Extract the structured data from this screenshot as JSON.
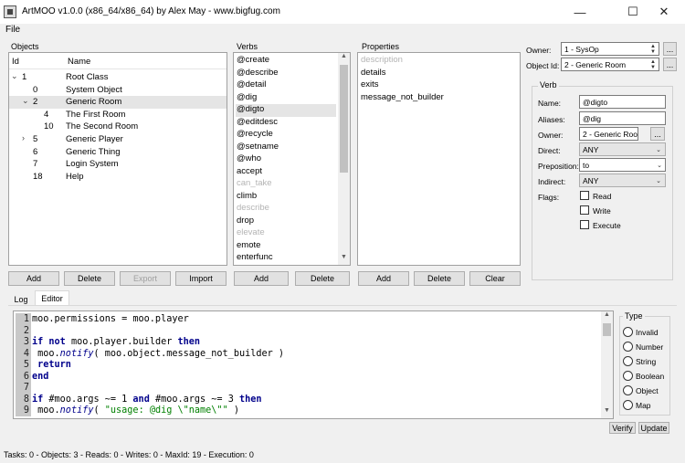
{
  "window": {
    "title": "ArtMOO v1.0.0 (x86_64/x86_64) by Alex May - www.bigfug.com",
    "minimize": "—",
    "maximize": "☐",
    "close": "✕"
  },
  "menu": {
    "file": "File"
  },
  "objects": {
    "label": "Objects",
    "col_id": "Id",
    "col_name": "Name",
    "rows": [
      {
        "id": "1",
        "name": "Root Class",
        "level": 0,
        "arrow": "⌄"
      },
      {
        "id": "0",
        "name": "System Object",
        "level": 1,
        "arrow": ""
      },
      {
        "id": "2",
        "name": "Generic Room",
        "level": 1,
        "arrow": "⌄",
        "selected": true
      },
      {
        "id": "4",
        "name": "The First Room",
        "level": 2,
        "arrow": ""
      },
      {
        "id": "10",
        "name": "The Second Room",
        "level": 2,
        "arrow": ""
      },
      {
        "id": "5",
        "name": "Generic Player",
        "level": 1,
        "arrow": "›"
      },
      {
        "id": "6",
        "name": "Generic Thing",
        "level": 1,
        "arrow": ""
      },
      {
        "id": "7",
        "name": "Login System",
        "level": 1,
        "arrow": ""
      },
      {
        "id": "18",
        "name": "Help",
        "level": 1,
        "arrow": ""
      }
    ],
    "buttons": {
      "add": "Add",
      "delete": "Delete",
      "export": "Export",
      "import": "Import"
    }
  },
  "verbs": {
    "label": "Verbs",
    "items": [
      {
        "text": "@create"
      },
      {
        "text": "@describe"
      },
      {
        "text": "@detail"
      },
      {
        "text": "@dig"
      },
      {
        "text": "@digto",
        "selected": true
      },
      {
        "text": "@editdesc"
      },
      {
        "text": "@recycle"
      },
      {
        "text": "@setname"
      },
      {
        "text": "@who"
      },
      {
        "text": "accept"
      },
      {
        "text": "can_take",
        "dim": true
      },
      {
        "text": "climb"
      },
      {
        "text": "describe",
        "dim": true
      },
      {
        "text": "drop"
      },
      {
        "text": "elevate",
        "dim": true
      },
      {
        "text": "emote"
      },
      {
        "text": "enterfunc"
      }
    ],
    "buttons": {
      "add": "Add",
      "delete": "Delete"
    }
  },
  "properties": {
    "label": "Properties",
    "items": [
      {
        "text": "description",
        "dim": true
      },
      {
        "text": "details"
      },
      {
        "text": "exits"
      },
      {
        "text": "message_not_builder"
      }
    ],
    "buttons": {
      "add": "Add",
      "delete": "Delete",
      "clear": "Clear"
    }
  },
  "top_right": {
    "owner_label": "Owner:",
    "owner_value": "1 - SysOp",
    "object_id_label": "Object Id:",
    "object_id_value": "2 - Generic Room",
    "browse": "..."
  },
  "verb_panel": {
    "title": "Verb",
    "name_label": "Name:",
    "name_value": "@digto",
    "aliases_label": "Aliases:",
    "aliases_value": "@dig",
    "owner_label": "Owner:",
    "owner_value": "2 - Generic Room",
    "browse": "...",
    "direct_label": "Direct:",
    "direct_value": "ANY",
    "preposition_label": "Preposition:",
    "preposition_value": "to",
    "indirect_label": "Indirect:",
    "indirect_value": "ANY",
    "flags_label": "Flags:",
    "flag_read": "Read",
    "flag_write": "Write",
    "flag_execute": "Execute"
  },
  "tabs": {
    "log": "Log",
    "editor": "Editor"
  },
  "editor": {
    "lines": [
      {
        "n": "1",
        "parts": [
          {
            "t": "moo.permissions = moo.player",
            "c": ""
          }
        ]
      },
      {
        "n": "2",
        "parts": []
      },
      {
        "n": "3",
        "parts": [
          {
            "t": "if not",
            "c": "kw"
          },
          {
            "t": " moo.player.builder ",
            "c": ""
          },
          {
            "t": "then",
            "c": "kw"
          }
        ]
      },
      {
        "n": "4",
        "parts": [
          {
            "t": " moo.",
            "c": ""
          },
          {
            "t": "notify",
            "c": "fn"
          },
          {
            "t": "( moo.object.message_not_builder )",
            "c": ""
          }
        ]
      },
      {
        "n": "5",
        "parts": [
          {
            "t": " return",
            "c": "kw"
          }
        ]
      },
      {
        "n": "6",
        "parts": [
          {
            "t": "end",
            "c": "kw"
          }
        ]
      },
      {
        "n": "7",
        "parts": []
      },
      {
        "n": "8",
        "parts": [
          {
            "t": "if",
            "c": "kw"
          },
          {
            "t": " #moo.args ~= 1 ",
            "c": ""
          },
          {
            "t": "and",
            "c": "kw"
          },
          {
            "t": " #moo.args ~= 3 ",
            "c": ""
          },
          {
            "t": "then",
            "c": "kw"
          }
        ]
      },
      {
        "n": "9",
        "parts": [
          {
            "t": " moo.",
            "c": ""
          },
          {
            "t": "notify",
            "c": "fn"
          },
          {
            "t": "( ",
            "c": ""
          },
          {
            "t": "\"usage: @dig \\\"name\\\"\"",
            "c": "str"
          },
          {
            "t": " )",
            "c": ""
          }
        ]
      }
    ]
  },
  "type_panel": {
    "title": "Type",
    "options": [
      "Invalid",
      "Number",
      "String",
      "Boolean",
      "Object",
      "Map"
    ]
  },
  "actions": {
    "verify": "Verify",
    "update": "Update"
  },
  "status": "Tasks: 0 - Objects: 3 - Reads: 0 - Writes: 0 - MaxId: 19 - Execution: 0"
}
